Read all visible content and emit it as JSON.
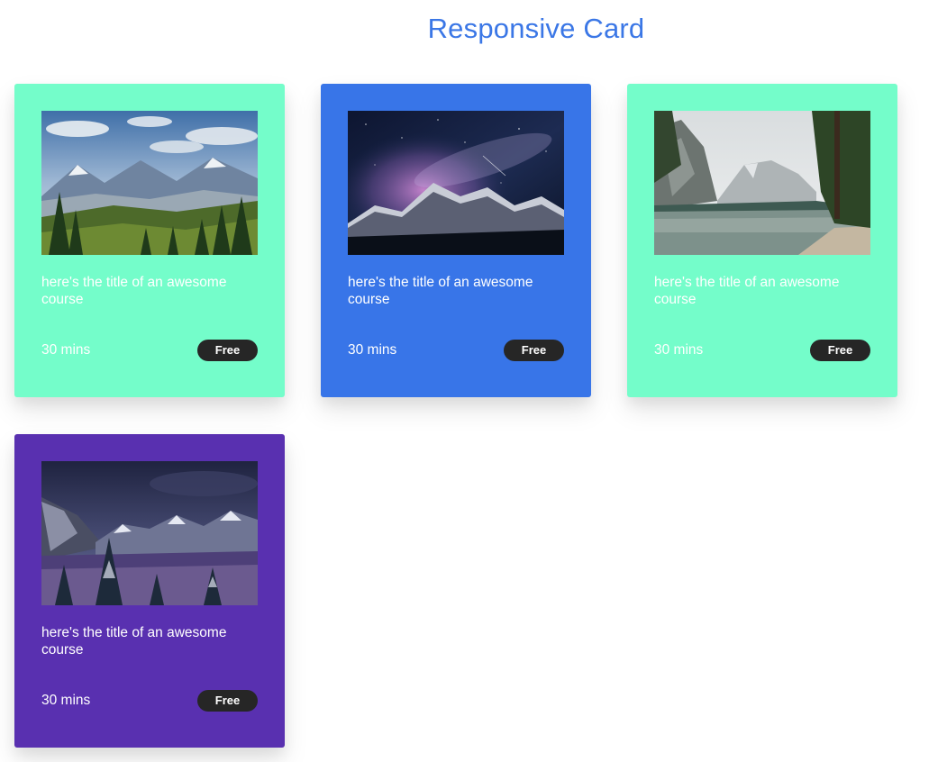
{
  "header": {
    "title": "Responsive Card",
    "title_color": "#3b77e6"
  },
  "cards": [
    {
      "background": "#74fdca",
      "image": "mountain-valley-forest-photo",
      "title": "here's the title of an awesome course",
      "duration": "30 mins",
      "badge": "Free"
    },
    {
      "background": "#3875e8",
      "image": "milky-way-mountains-photo",
      "title": "here's the title of an awesome course",
      "duration": "30 mins",
      "badge": "Free"
    },
    {
      "background": "#74fdca",
      "image": "alpine-lake-reflection-photo",
      "title": "here's the title of an awesome course",
      "duration": "30 mins",
      "badge": "Free"
    },
    {
      "background": "#5930b0",
      "image": "snowy-valley-forest-photo",
      "title": "here's the title of an awesome course",
      "duration": "30 mins",
      "badge": "Free"
    }
  ],
  "badge_color": "#262626"
}
